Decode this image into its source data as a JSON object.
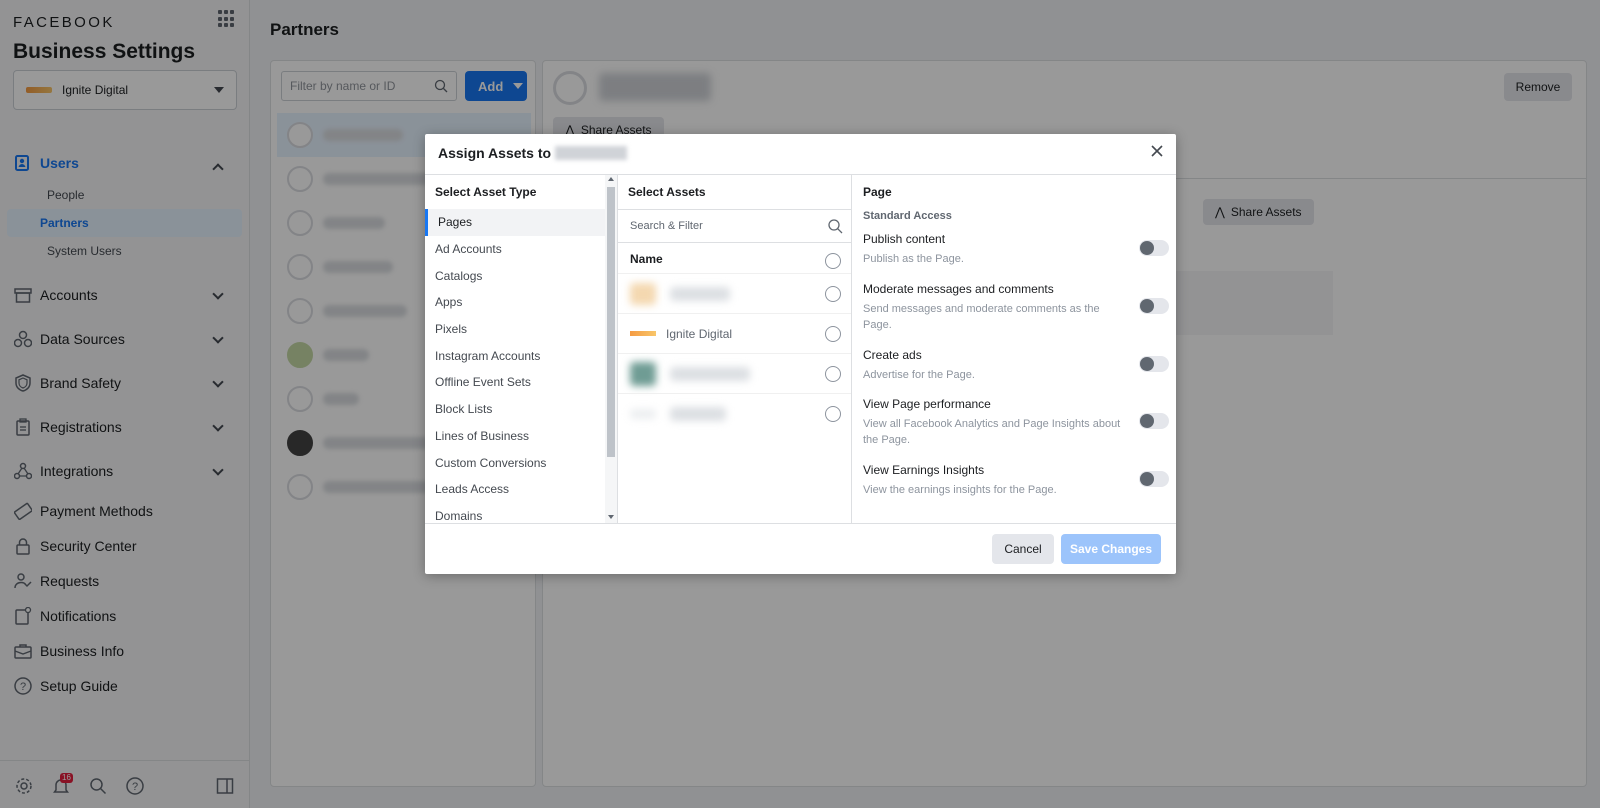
{
  "sidebar": {
    "brand": "FACEBOOK",
    "title": "Business Settings",
    "business": "Ignite Digital",
    "users_label": "Users",
    "sub_items": [
      "People",
      "Partners",
      "System Users"
    ],
    "sections": [
      "Accounts",
      "Data Sources",
      "Brand Safety",
      "Registrations",
      "Integrations"
    ],
    "links": [
      "Payment Methods",
      "Security Center",
      "Requests",
      "Notifications",
      "Business Info",
      "Setup Guide"
    ],
    "notification_count": "16"
  },
  "main": {
    "title": "Partners",
    "filter_placeholder": "Filter by name or ID",
    "add_label": "Add",
    "remove_label": "Remove",
    "share_assets_label": "Share Assets"
  },
  "modal": {
    "title": "Assign Assets to",
    "col1_header": "Select Asset Type",
    "asset_types": [
      "Pages",
      "Ad Accounts",
      "Catalogs",
      "Apps",
      "Pixels",
      "Instagram Accounts",
      "Offline Event Sets",
      "Block Lists",
      "Lines of Business",
      "Custom Conversions",
      "Leads Access",
      "Domains"
    ],
    "col2_header": "Select Assets",
    "search_placeholder": "Search & Filter",
    "name_header": "Name",
    "visible_asset": "Ignite Digital",
    "col3_header": "Page",
    "standard_access": "Standard Access",
    "permissions": [
      {
        "title": "Publish content",
        "desc": "Publish as the Page."
      },
      {
        "title": "Moderate messages and comments",
        "desc": "Send messages and moderate comments as the Page."
      },
      {
        "title": "Create ads",
        "desc": "Advertise for the Page."
      },
      {
        "title": "View Page performance",
        "desc": "View all Facebook Analytics and Page Insights about the Page."
      },
      {
        "title": "View Earnings Insights",
        "desc": "View the earnings insights for the Page."
      }
    ],
    "cancel_label": "Cancel",
    "save_label": "Save Changes"
  },
  "colors": {
    "accent": "#1877f2",
    "save_disabled": "#9cc4fb"
  }
}
